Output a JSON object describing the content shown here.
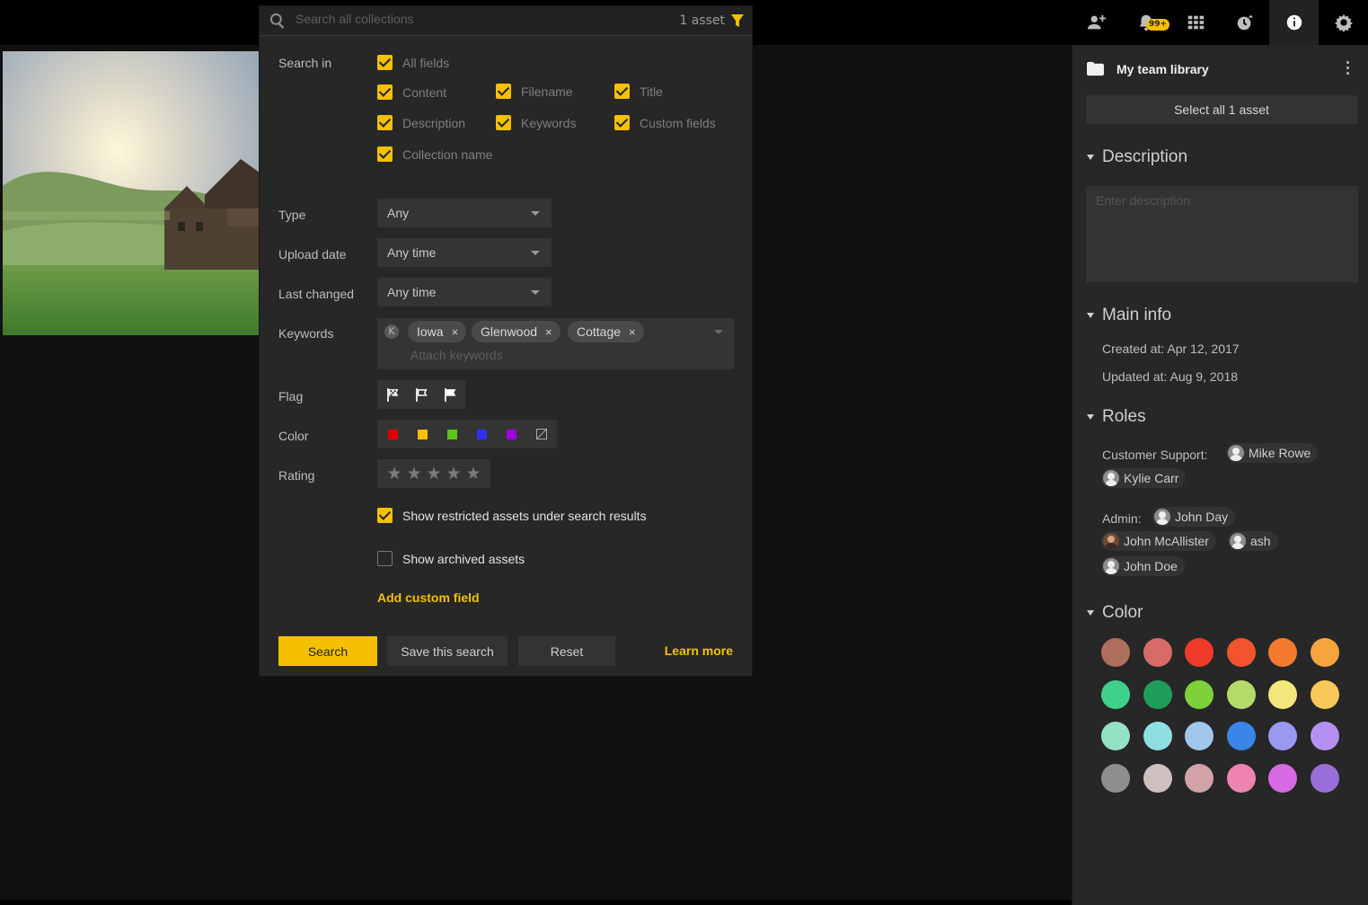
{
  "topbar": {
    "notifications_badge": "99+",
    "icons": [
      "add-user-icon",
      "bell-icon",
      "grid-icon",
      "history-icon",
      "info-icon",
      "gear-icon"
    ]
  },
  "search": {
    "placeholder": "Search all collections",
    "asset_count": "1 asset",
    "search_in_label": "Search in",
    "checkboxes": {
      "all_fields": "All fields",
      "content": "Content",
      "filename": "Filename",
      "title": "Title",
      "description": "Description",
      "keywords": "Keywords",
      "custom_fields": "Custom fields",
      "collection_name": "Collection name"
    },
    "type_label": "Type",
    "type_value": "Any",
    "upload_label": "Upload date",
    "upload_value": "Any time",
    "changed_label": "Last changed",
    "changed_value": "Any time",
    "keywords_label": "Keywords",
    "keyword_k": "K",
    "keyword_chips": [
      "Iowa",
      "Glenwood",
      "Cottage"
    ],
    "keyword_remove": "×",
    "keyword_placeholder": "Attach keywords",
    "flag_label": "Flag",
    "color_label": "Color",
    "filter_colors": [
      "#e00000",
      "#f5c000",
      "#5cc51a",
      "#2f2fff",
      "#a000e0"
    ],
    "rating_label": "Rating",
    "star_glyph": "★",
    "show_restricted": "Show restricted assets under search results",
    "show_archived": "Show archived assets",
    "add_custom_field": "Add custom field",
    "buttons": {
      "search": "Search",
      "save": "Save this search",
      "reset": "Reset",
      "learn_more": "Learn more"
    }
  },
  "sidebar": {
    "library_title": "My team library",
    "select_all": "Select all 1 asset",
    "description_title": "Description",
    "description_placeholder": "Enter description",
    "main_info_title": "Main info",
    "created": "Created at: Apr 12, 2017",
    "updated": "Updated at: Aug 9, 2018",
    "roles_title": "Roles",
    "customer_support_label": "Customer Support:",
    "customer_support_users": [
      "Mike Rowe",
      "Kylie Carr"
    ],
    "admin_label": "Admin:",
    "admin_users": [
      "John Day",
      "John McAllister",
      "ash",
      "John Doe"
    ],
    "color_title": "Color",
    "palette": [
      "#b06e5c",
      "#d86a6a",
      "#f03a2a",
      "#f2552e",
      "#f57a30",
      "#f5a53c",
      "#3ed18b",
      "#1f9e5a",
      "#7fd03a",
      "#b4db6a",
      "#f4e67c",
      "#f8c858",
      "#93e2c4",
      "#8ee0e0",
      "#a0c8ea",
      "#3a86e8",
      "#9999f2",
      "#b390f2",
      "#8e8e8e",
      "#d0bfbf",
      "#d2a2a6",
      "#ee84b0",
      "#d66ae2",
      "#9a6ed8"
    ]
  }
}
